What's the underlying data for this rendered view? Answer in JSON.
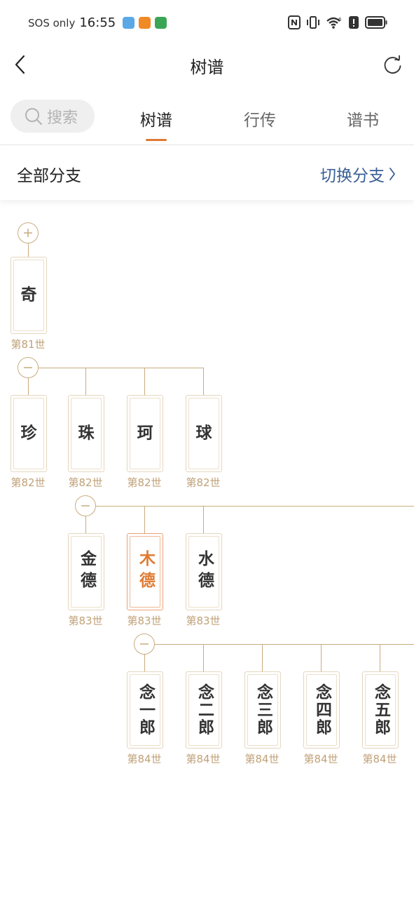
{
  "status_bar": {
    "carrier": "SOS only",
    "time": "16:55",
    "icons": [
      "nfc-icon",
      "vibrate-icon",
      "wifi-icon",
      "alert-icon",
      "battery-icon"
    ],
    "wifi_badge": "6"
  },
  "header": {
    "title": "树谱",
    "back_icon": "chevron-left-icon",
    "refresh_icon": "refresh-icon"
  },
  "tabs": {
    "search_placeholder": "搜索",
    "items": [
      {
        "label": "树谱",
        "active": true
      },
      {
        "label": "行传",
        "active": false
      },
      {
        "label": "谱书",
        "active": false
      }
    ],
    "accent": "#e07a32"
  },
  "branch": {
    "label": "全部分支",
    "switch_label": "切换分支",
    "switch_color": "#3a5f95"
  },
  "tree": {
    "gen81": [
      {
        "name": "奇",
        "gen": "第81世",
        "toggle": "+"
      }
    ],
    "gen82": [
      {
        "name": "珍",
        "gen": "第82世"
      },
      {
        "name": "珠",
        "gen": "第82世"
      },
      {
        "name": "珂",
        "gen": "第82世"
      },
      {
        "name": "球",
        "gen": "第82世"
      }
    ],
    "gen83": [
      {
        "name": "金德",
        "gen": "第83世"
      },
      {
        "name": "木德",
        "gen": "第83世",
        "selected": true
      },
      {
        "name": "水德",
        "gen": "第83世"
      }
    ],
    "gen84": [
      {
        "name": "念一郎",
        "gen": "第84世"
      },
      {
        "name": "念二郎",
        "gen": "第84世"
      },
      {
        "name": "念三郎",
        "gen": "第84世"
      },
      {
        "name": "念四郎",
        "gen": "第84世"
      },
      {
        "name": "念五郎",
        "gen": "第84世"
      }
    ],
    "colors": {
      "line": "#c9ac7e",
      "selected": "#e07a32",
      "gen_text": "#c0a178"
    }
  }
}
